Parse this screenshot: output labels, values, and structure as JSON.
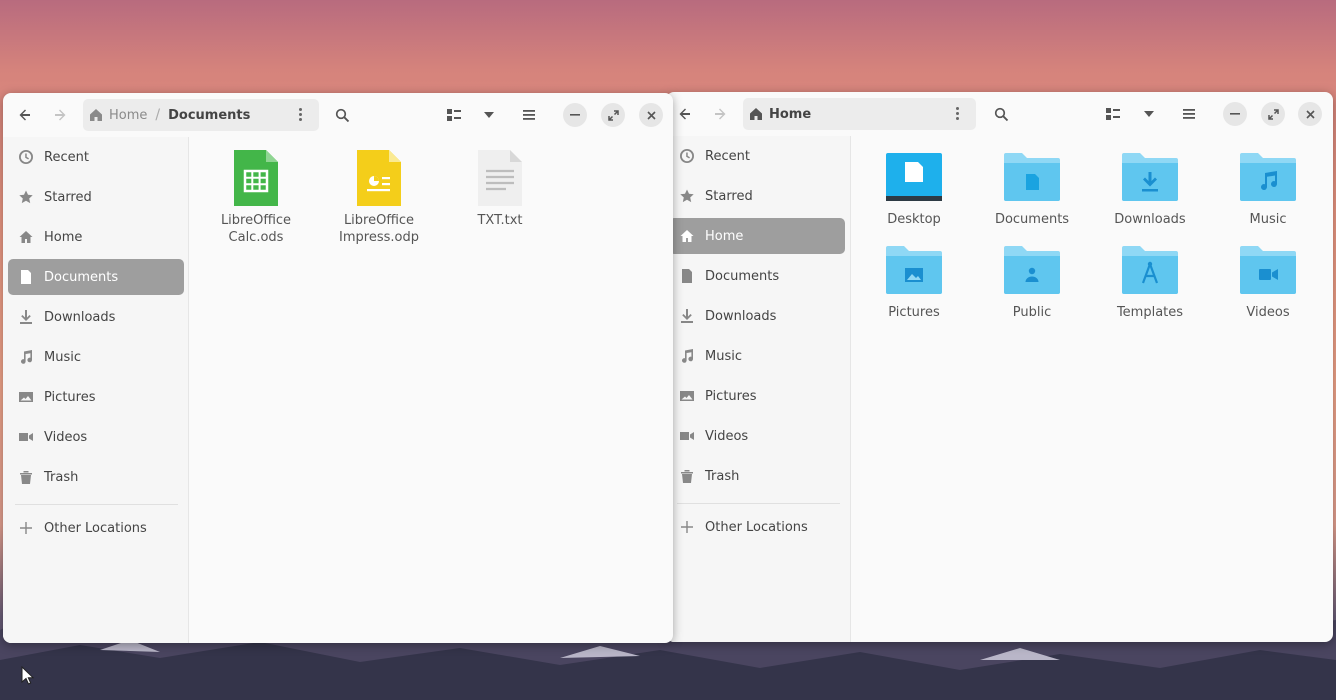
{
  "colors": {
    "selection": "#9e9e9e",
    "folder": "#5fc6ef",
    "calc_green": "#43b649",
    "impress_yellow": "#f4ce1a"
  },
  "left_window": {
    "breadcrumb": [
      "Home",
      "Documents"
    ],
    "sidebar": {
      "items": [
        {
          "label": "Recent",
          "icon": "clock-icon"
        },
        {
          "label": "Starred",
          "icon": "star-icon"
        },
        {
          "label": "Home",
          "icon": "home-icon"
        },
        {
          "label": "Documents",
          "icon": "document-icon",
          "selected": true
        },
        {
          "label": "Downloads",
          "icon": "download-icon"
        },
        {
          "label": "Music",
          "icon": "music-icon"
        },
        {
          "label": "Pictures",
          "icon": "picture-icon"
        },
        {
          "label": "Videos",
          "icon": "video-icon"
        },
        {
          "label": "Trash",
          "icon": "trash-icon"
        }
      ],
      "other_locations": "Other Locations"
    },
    "files": [
      {
        "line1": "LibreOffice",
        "line2": "Calc.ods",
        "icon": "spreadsheet-icon"
      },
      {
        "line1": "LibreOffice",
        "line2": "Impress.odp",
        "icon": "presentation-icon"
      },
      {
        "line1": "TXT.txt",
        "line2": "",
        "icon": "text-file-icon"
      }
    ]
  },
  "right_window": {
    "breadcrumb": [
      "Home"
    ],
    "sidebar": {
      "items": [
        {
          "label": "Recent",
          "icon": "clock-icon"
        },
        {
          "label": "Starred",
          "icon": "star-icon"
        },
        {
          "label": "Home",
          "icon": "home-icon",
          "selected": true
        },
        {
          "label": "Documents",
          "icon": "document-icon"
        },
        {
          "label": "Downloads",
          "icon": "download-icon"
        },
        {
          "label": "Music",
          "icon": "music-icon"
        },
        {
          "label": "Pictures",
          "icon": "picture-icon"
        },
        {
          "label": "Videos",
          "icon": "video-icon"
        },
        {
          "label": "Trash",
          "icon": "trash-icon"
        }
      ],
      "other_locations": "Other Locations"
    },
    "folders": [
      {
        "label": "Desktop",
        "icon": "desktop-folder-icon"
      },
      {
        "label": "Documents",
        "icon": "documents-folder-icon"
      },
      {
        "label": "Downloads",
        "icon": "downloads-folder-icon"
      },
      {
        "label": "Music",
        "icon": "music-folder-icon"
      },
      {
        "label": "Pictures",
        "icon": "pictures-folder-icon"
      },
      {
        "label": "Public",
        "icon": "public-folder-icon"
      },
      {
        "label": "Templates",
        "icon": "templates-folder-icon"
      },
      {
        "label": "Videos",
        "icon": "videos-folder-icon"
      }
    ]
  }
}
